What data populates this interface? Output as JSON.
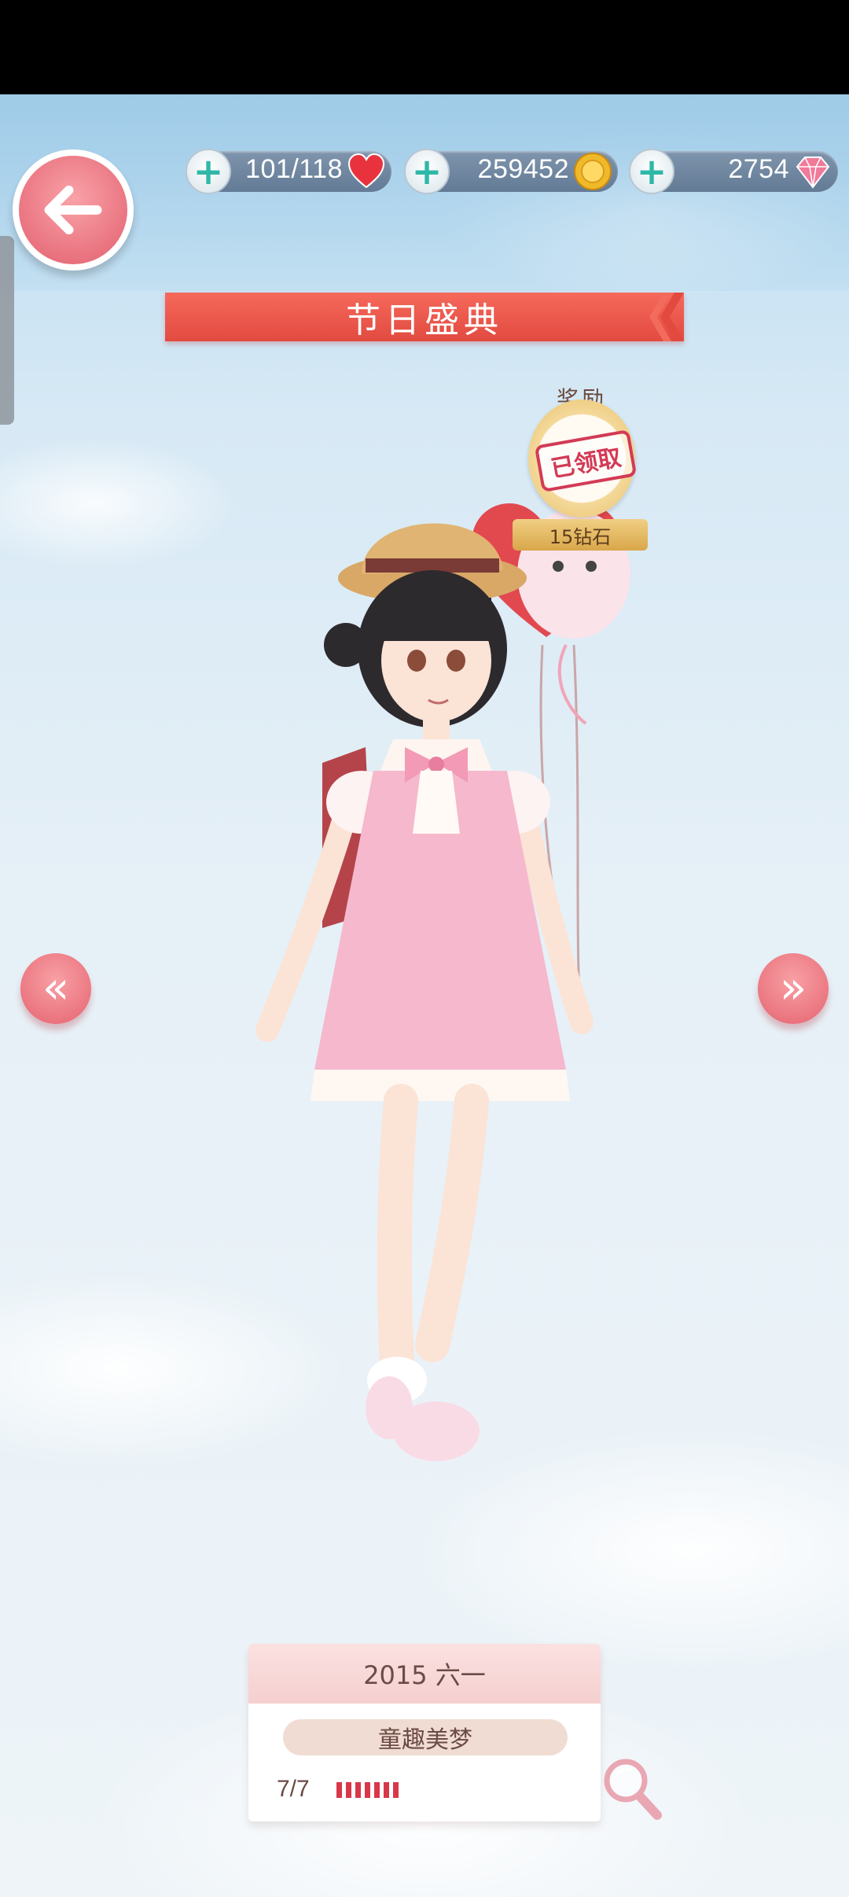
{
  "resources": {
    "stamina": {
      "value": "101/118",
      "icon": "heart-icon"
    },
    "gold": {
      "value": "259452",
      "icon": "gold-coin-icon"
    },
    "diamonds": {
      "value": "2754",
      "icon": "diamond-icon"
    }
  },
  "banner": {
    "title": "节日盛典"
  },
  "reward": {
    "title": "奖励",
    "stamp": "已领取",
    "amount": "15钻石"
  },
  "card": {
    "event": "2015 六一",
    "suit_name": "童趣美梦",
    "progress_text": "7/7",
    "progress_bars": 7
  },
  "colors": {
    "accent": "#e24a40",
    "button_pink": "#e56470",
    "progress_red": "#d8374a"
  },
  "nav": {
    "prev_glyph": "«",
    "next_glyph": "»"
  }
}
